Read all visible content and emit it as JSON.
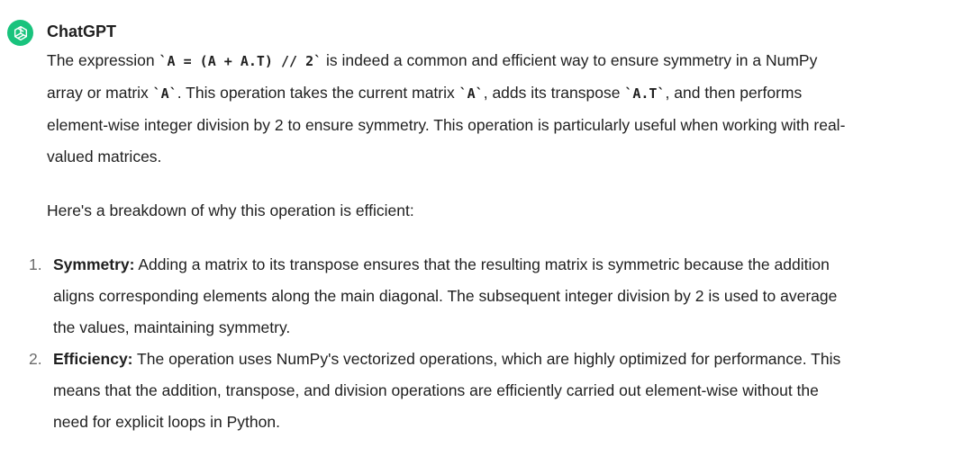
{
  "message": {
    "sender": "ChatGPT",
    "paragraph1": {
      "t1": "The expression ",
      "c1": "`A = (A + A.T) // 2`",
      "t2": " is indeed a common and efficient way to ensure symmetry in a NumPy array or matrix ",
      "c2": "`A`",
      "t3": ". This operation takes the current matrix ",
      "c3": "`A`",
      "t4": ", adds its transpose ",
      "c4": "`A.T`",
      "t5": ", and then performs element-wise integer division by 2 to ensure symmetry. This operation is particularly useful when working with real-valued matrices."
    },
    "paragraph2": "Here's a breakdown of why this operation is efficient:",
    "list": [
      {
        "number": "1.",
        "title": "Symmetry:",
        "text": " Adding a matrix to its transpose ensures that the resulting matrix is symmetric because the addition aligns corresponding elements along the main diagonal. The subsequent integer division by 2 is used to average the values, maintaining symmetry."
      },
      {
        "number": "2.",
        "title": "Efficiency:",
        "text": " The operation uses NumPy's vectorized operations, which are highly optimized for performance. This means that the addition, transpose, and division operations are efficiently carried out element-wise without the need for explicit loops in Python."
      }
    ]
  }
}
